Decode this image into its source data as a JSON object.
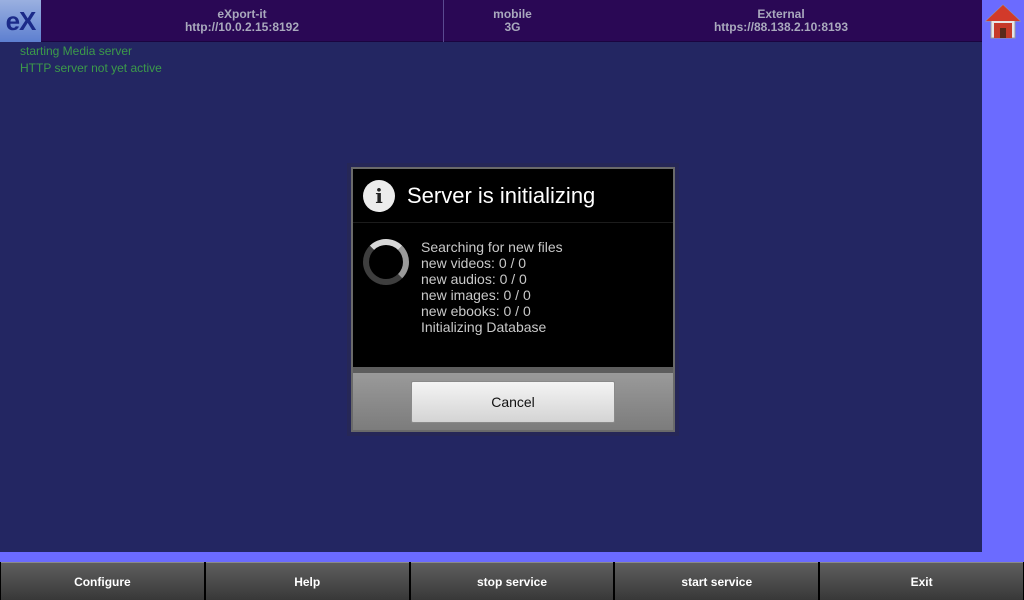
{
  "header": {
    "logo": "eX",
    "cells": [
      {
        "title": "eXport-it",
        "value": "http://10.0.2.15:8192"
      },
      {
        "title": "mobile",
        "value": "3G"
      },
      {
        "title": "External",
        "value": "https://88.138.2.10:8193"
      }
    ]
  },
  "status": {
    "line1": "starting Media server",
    "line2": "HTTP server not yet active"
  },
  "dialog": {
    "title": "Server is initializing",
    "lines": [
      "Searching for new files",
      "new videos: 0 / 0",
      "new audios: 0 / 0",
      "new images: 0 / 0",
      "new ebooks: 0 / 0",
      "Initializing Database"
    ],
    "cancel_label": "Cancel"
  },
  "bottom_bar": {
    "buttons": [
      "Configure",
      "Help",
      "stop service",
      "start service",
      "Exit"
    ]
  },
  "colors": {
    "header_bg": "#2a0855",
    "main_bg": "#232662",
    "side_bg": "#6b6bff",
    "status_text": "#3c9a4a"
  },
  "icons": {
    "logo": "ex-logo",
    "home": "home-icon",
    "info": "info-icon",
    "spinner": "progress-spinner"
  }
}
